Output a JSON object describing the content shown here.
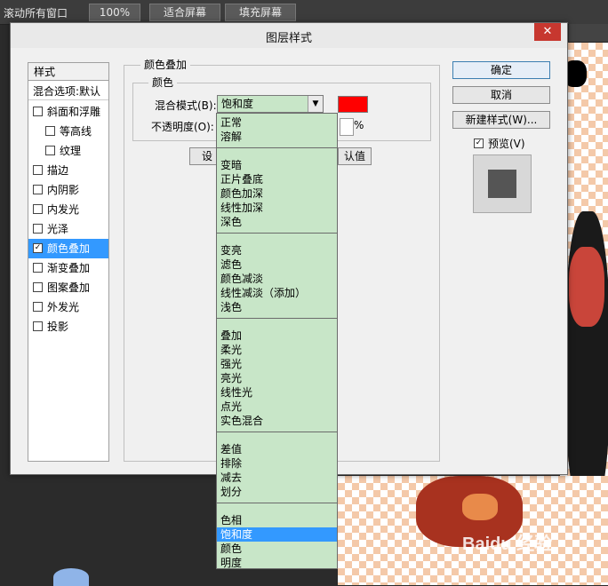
{
  "topbar": {
    "scroll_all_windows": "滚动所有窗口",
    "zoom_100": "100%",
    "fit_screen": "适合屏幕",
    "fill_screen": "填充屏幕"
  },
  "dialog": {
    "title": "图层样式",
    "close": "✕"
  },
  "styles_panel": {
    "header": "样式",
    "blend_options": "混合选项:默认",
    "items": [
      {
        "label": "斜面和浮雕",
        "checked": false
      },
      {
        "label": "等高线",
        "checked": false
      },
      {
        "label": "纹理",
        "checked": false
      },
      {
        "label": "描边",
        "checked": false
      },
      {
        "label": "内阴影",
        "checked": false
      },
      {
        "label": "内发光",
        "checked": false
      },
      {
        "label": "光泽",
        "checked": false
      },
      {
        "label": "颜色叠加",
        "checked": true
      },
      {
        "label": "渐变叠加",
        "checked": false
      },
      {
        "label": "图案叠加",
        "checked": false
      },
      {
        "label": "外发光",
        "checked": false
      },
      {
        "label": "投影",
        "checked": false
      }
    ]
  },
  "color_overlay": {
    "group_title": "颜色叠加",
    "sub_title": "颜色",
    "blend_mode_label": "混合模式(B):",
    "blend_mode_value": "饱和度",
    "overlay_color": "#ff0000",
    "opacity_label": "不透明度(O):",
    "opacity_unit": "%",
    "set_default_partial": "设",
    "reset_default_partial": "认值"
  },
  "buttons": {
    "ok": "确定",
    "cancel": "取消",
    "new_style": "新建样式(W)...",
    "preview": "预览(V)"
  },
  "dropdown": {
    "groups": [
      [
        "正常",
        "溶解"
      ],
      [
        "变暗",
        "正片叠底",
        "颜色加深",
        "线性加深",
        "深色"
      ],
      [
        "变亮",
        "滤色",
        "颜色减淡",
        "线性减淡（添加）",
        "浅色"
      ],
      [
        "叠加",
        "柔光",
        "强光",
        "亮光",
        "线性光",
        "点光",
        "实色混合"
      ],
      [
        "差值",
        "排除",
        "减去",
        "划分"
      ],
      [
        "色相",
        "饱和度",
        "颜色",
        "明度"
      ]
    ],
    "selected": "饱和度"
  },
  "watermark": "Baidu 经验"
}
